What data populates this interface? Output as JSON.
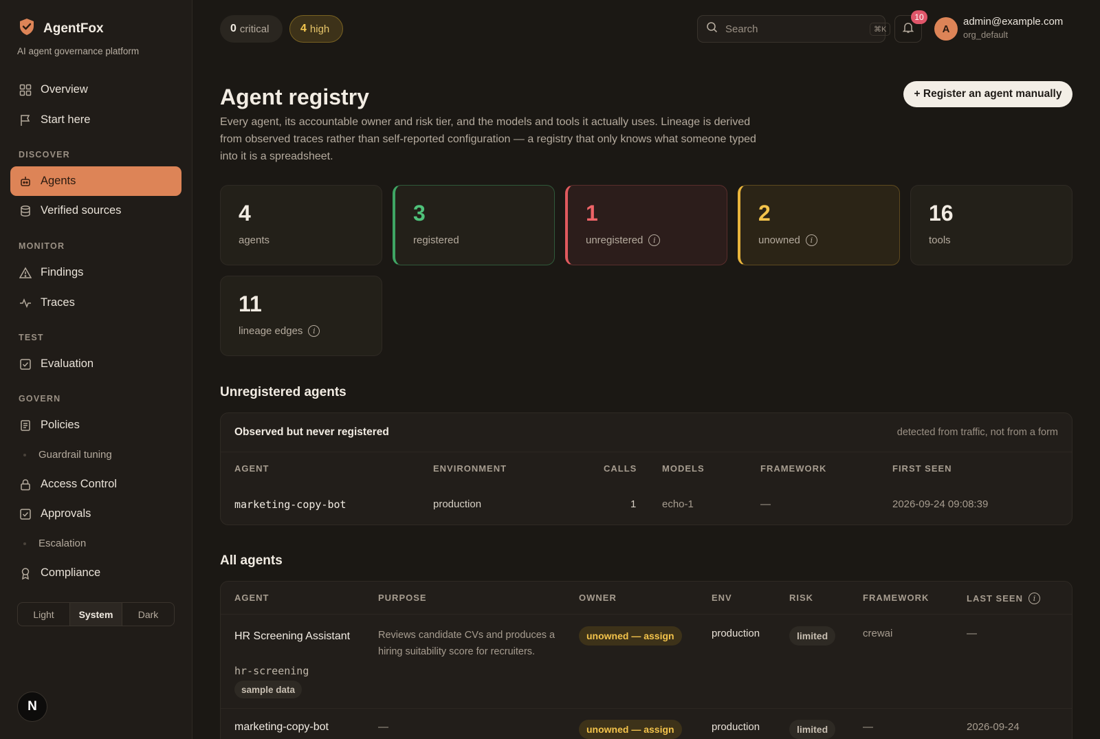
{
  "brand": {
    "name": "AgentFox",
    "tagline": "AI agent governance platform"
  },
  "sidebar": {
    "items": [
      {
        "label": "Overview"
      },
      {
        "label": "Start here"
      },
      {
        "label": "Agents"
      },
      {
        "label": "Verified sources"
      },
      {
        "label": "Findings"
      },
      {
        "label": "Traces"
      },
      {
        "label": "Evaluation"
      },
      {
        "label": "Policies"
      },
      {
        "label": "Guardrail tuning"
      },
      {
        "label": "Access Control"
      },
      {
        "label": "Approvals"
      },
      {
        "label": "Escalation"
      },
      {
        "label": "Compliance"
      }
    ],
    "sections": {
      "discover": "DISCOVER",
      "monitor": "MONITOR",
      "test": "TEST",
      "govern": "GOVERN"
    },
    "theme": {
      "light": "Light",
      "system": "System",
      "dark": "Dark"
    },
    "n_badge": "N"
  },
  "topbar": {
    "critical_count": "0",
    "critical_label": "critical",
    "high_count": "4",
    "high_label": "high",
    "search_placeholder": "Search",
    "search_shortcut": "⌘K",
    "notifications": "10",
    "avatar_initial": "A",
    "user_email": "admin@example.com",
    "user_org": "org_default"
  },
  "page": {
    "title": "Agent registry",
    "description": "Every agent, its accountable owner and risk tier, and the models and tools it actually uses. Lineage is derived from observed traces rather than self-reported configuration — a registry that only knows what someone typed into it is a spreadsheet.",
    "register_button": "+ Register an agent manually"
  },
  "stats": [
    {
      "value": "4",
      "label": "agents"
    },
    {
      "value": "3",
      "label": "registered"
    },
    {
      "value": "1",
      "label": "unregistered"
    },
    {
      "value": "2",
      "label": "unowned"
    },
    {
      "value": "16",
      "label": "tools"
    },
    {
      "value": "11",
      "label": "lineage edges"
    }
  ],
  "unregistered": {
    "section_title": "Unregistered agents",
    "card_title": "Observed but never registered",
    "card_note": "detected from traffic, not from a form",
    "columns": [
      "AGENT",
      "ENVIRONMENT",
      "CALLS",
      "MODELS",
      "FRAMEWORK",
      "FIRST SEEN"
    ],
    "rows": [
      {
        "agent": "marketing-copy-bot",
        "environment": "production",
        "calls": "1",
        "models": "echo-1",
        "framework": "—",
        "first_seen": "2026-09-24 09:08:39"
      }
    ]
  },
  "all_agents": {
    "section_title": "All agents",
    "columns": [
      "AGENT",
      "PURPOSE",
      "OWNER",
      "ENV",
      "RISK",
      "FRAMEWORK",
      "LAST SEEN"
    ],
    "rows": [
      {
        "name": "HR Screening Assistant",
        "slug": "hr-screening",
        "tag": "sample data",
        "purpose": "Reviews candidate CVs and produces a hiring suitability score for recruiters.",
        "owner": "unowned — assign",
        "env": "production",
        "risk": "limited",
        "framework": "crewai",
        "last_seen": "—"
      },
      {
        "name": "marketing-copy-bot",
        "purpose": "—",
        "owner": "unowned — assign",
        "env": "production",
        "risk": "limited",
        "framework": "—",
        "last_seen": "2026-09-24"
      }
    ]
  },
  "colors": {
    "accent": "#dd8457",
    "green": "#4fc27a",
    "red": "#ef6468",
    "amber": "#f3c34b"
  }
}
